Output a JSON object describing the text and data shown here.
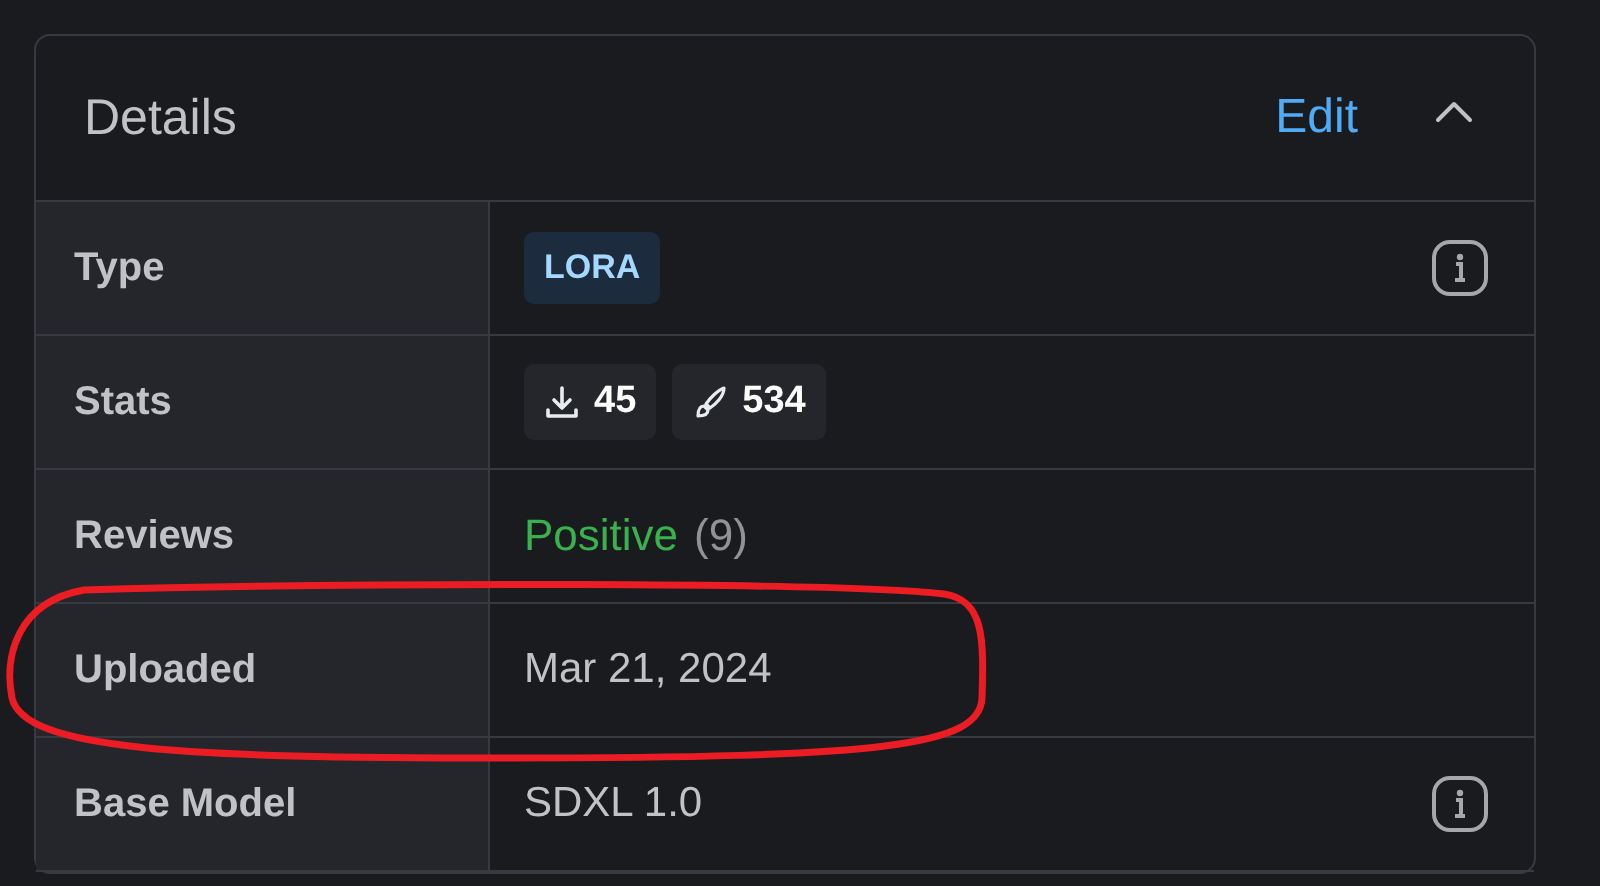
{
  "card": {
    "title": "Details",
    "edit_link": "Edit",
    "expanded": true
  },
  "rows": [
    {
      "label": "Type",
      "kind": "badge",
      "badge": "LORA",
      "info": true,
      "highlighted": false
    },
    {
      "label": "Stats",
      "kind": "stats",
      "downloads": "45",
      "generations": "534",
      "info": false,
      "highlighted": false
    },
    {
      "label": "Reviews",
      "kind": "review",
      "rating": "Positive",
      "count": "(9)",
      "info": false,
      "highlighted": false
    },
    {
      "label": "Uploaded",
      "kind": "text",
      "value": "Mar 21, 2024",
      "info": false,
      "highlighted": true
    },
    {
      "label": "Base Model",
      "kind": "text",
      "value": "SDXL 1.0",
      "info": true,
      "highlighted": false
    }
  ]
}
